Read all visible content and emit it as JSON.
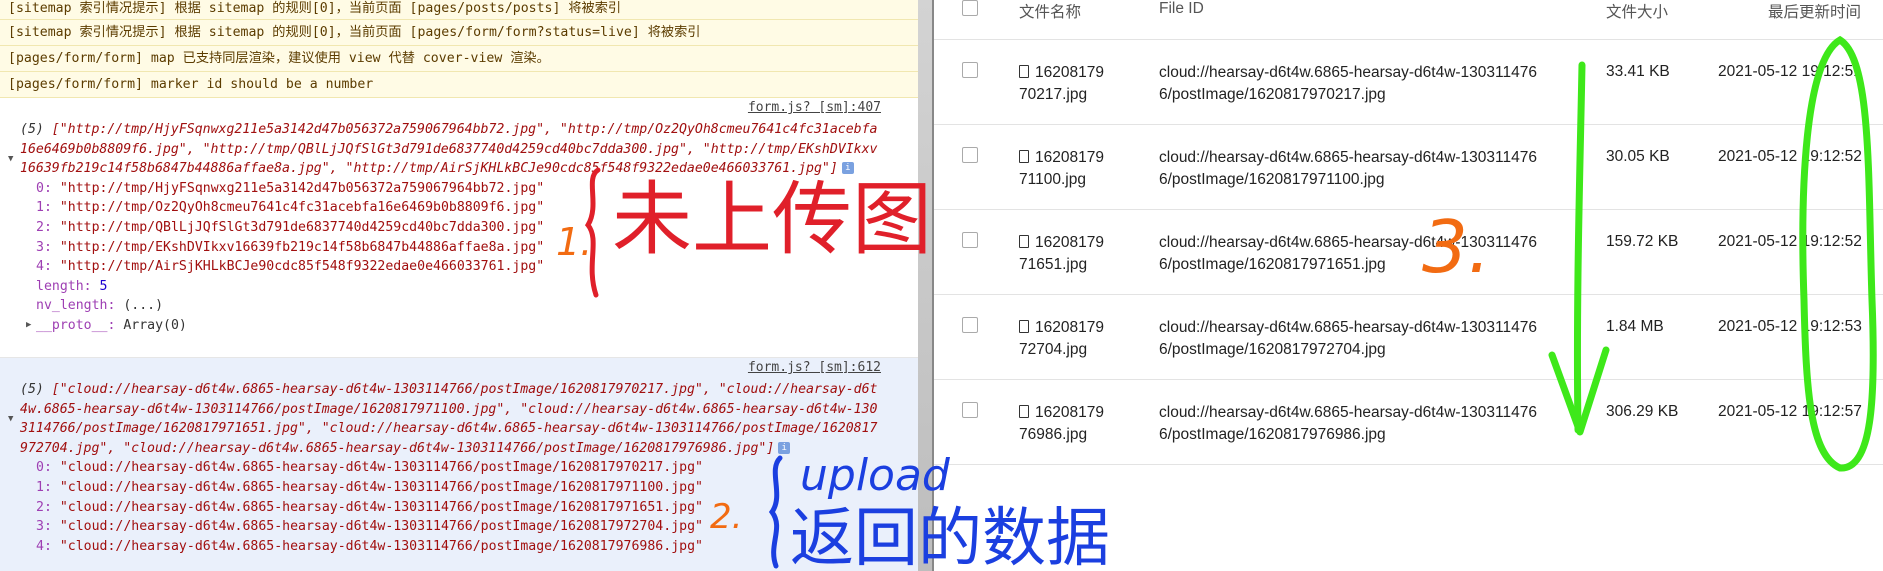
{
  "console": {
    "warnings": [
      "[sitemap 索引情况提示] 根据 sitemap 的规则[0]，当前页面 [pages/posts/posts] 将被索引",
      "[sitemap 索引情况提示] 根据 sitemap 的规则[0]，当前页面 [pages/form/form?status=live] 将被索引",
      "[pages/form/form] map 已支持同层渲染，建议使用 view 代替 cover-view 渲染。",
      "[pages/form/form] marker id should be a number"
    ],
    "log1": {
      "source": "form.js? [sm]:407",
      "count": "(5)",
      "summary": "[\"http://tmp/HjyFSqnwxg211e5a3142d47b056372a759067964bb72.jpg\", \"http://tmp/Oz2QyOh8cmeu7641c4fc31acebfa16e6469b0b8809f6.jpg\", \"http://tmp/QBlLjJQfSlGt3d791de6837740d4259cd40bc7dda300.jpg\", \"http://tmp/EKshDVIkxv16639fb219c14f58b6847b44886affae8a.jpg\", \"http://tmp/AirSjKHLkBCJe90cdc85f548f9322edae0e466033761.jpg\"]",
      "items": [
        {
          "idx": "0:",
          "val": "\"http://tmp/HjyFSqnwxg211e5a3142d47b056372a759067964bb72.jpg\""
        },
        {
          "idx": "1:",
          "val": "\"http://tmp/Oz2QyOh8cmeu7641c4fc31acebfa16e6469b0b8809f6.jpg\""
        },
        {
          "idx": "2:",
          "val": "\"http://tmp/QBlLjJQfSlGt3d791de6837740d4259cd40bc7dda300.jpg\""
        },
        {
          "idx": "3:",
          "val": "\"http://tmp/EKshDVIkxv16639fb219c14f58b6847b44886affae8a.jpg\""
        },
        {
          "idx": "4:",
          "val": "\"http://tmp/AirSjKHLkBCJe90cdc85f548f9322edae0e466033761.jpg\""
        }
      ],
      "length_key": "length:",
      "length_val": "5",
      "nvlength_key": "nv_length:",
      "nvlength_val": "(...)",
      "proto_key": "__proto__:",
      "proto_val": "Array(0)"
    },
    "log2": {
      "source": "form.js? [sm]:612",
      "count": "(5)",
      "summary": "[\"cloud://hearsay-d6t4w.6865-hearsay-d6t4w-1303114766/postImage/1620817970217.jpg\", \"cloud://hearsay-d6t4w.6865-hearsay-d6t4w-1303114766/postImage/1620817971100.jpg\", \"cloud://hearsay-d6t4w.6865-hearsay-d6t4w-1303114766/postImage/1620817971651.jpg\", \"cloud://hearsay-d6t4w.6865-hearsay-d6t4w-1303114766/postImage/1620817972704.jpg\", \"cloud://hearsay-d6t4w.6865-hearsay-d6t4w-1303114766/postImage/1620817976986.jpg\"]",
      "items": [
        {
          "idx": "0:",
          "val": "\"cloud://hearsay-d6t4w.6865-hearsay-d6t4w-1303114766/postImage/1620817970217.jpg\""
        },
        {
          "idx": "1:",
          "val": "\"cloud://hearsay-d6t4w.6865-hearsay-d6t4w-1303114766/postImage/1620817971100.jpg\""
        },
        {
          "idx": "2:",
          "val": "\"cloud://hearsay-d6t4w.6865-hearsay-d6t4w-1303114766/postImage/1620817971651.jpg\""
        },
        {
          "idx": "3:",
          "val": "\"cloud://hearsay-d6t4w.6865-hearsay-d6t4w-1303114766/postImage/1620817972704.jpg\""
        },
        {
          "idx": "4:",
          "val": "\"cloud://hearsay-d6t4w.6865-hearsay-d6t4w-1303114766/postImage/1620817976986.jpg\""
        }
      ]
    }
  },
  "table": {
    "headers": {
      "name": "文件名称",
      "fileid": "File ID",
      "size": "文件大小",
      "updated": "最后更新时间"
    },
    "rows": [
      {
        "name_1": "16208179",
        "name_2": "70217.jpg",
        "id_1": "cloud://hearsay-d6t4w.6865-hearsay-d6t4w-130311476",
        "id_2": "6/postImage/1620817970217.jpg",
        "size": "33.41 KB",
        "updated": "2021-05-12 19:12:51"
      },
      {
        "name_1": "16208179",
        "name_2": "71100.jpg",
        "id_1": "cloud://hearsay-d6t4w.6865-hearsay-d6t4w-130311476",
        "id_2": "6/postImage/1620817971100.jpg",
        "size": "30.05 KB",
        "updated": "2021-05-12 19:12:52"
      },
      {
        "name_1": "16208179",
        "name_2": "71651.jpg",
        "id_1": "cloud://hearsay-d6t4w.6865-hearsay-d6t4w-130311476",
        "id_2": "6/postImage/1620817971651.jpg",
        "size": "159.72 KB",
        "updated": "2021-05-12 19:12:52"
      },
      {
        "name_1": "16208179",
        "name_2": "72704.jpg",
        "id_1": "cloud://hearsay-d6t4w.6865-hearsay-d6t4w-130311476",
        "id_2": "6/postImage/1620817972704.jpg",
        "size": "1.84 MB",
        "updated": "2021-05-12 19:12:53"
      },
      {
        "name_1": "16208179",
        "name_2": "76986.jpg",
        "id_1": "cloud://hearsay-d6t4w.6865-hearsay-d6t4w-130311476",
        "id_2": "6/postImage/1620817976986.jpg",
        "size": "306.29 KB",
        "updated": "2021-05-12 19:12:57"
      }
    ]
  },
  "annotations": {
    "note1_num": "1.",
    "note1_text": "未上传图",
    "note2_num": "2.",
    "note2_upload": "upload",
    "note2_text": "返回的数据",
    "note3_num": "3.",
    "colors": {
      "red": "#e0202a",
      "orange": "#f26b12",
      "blue": "#1b3fe0",
      "green": "#3ee81a"
    }
  }
}
